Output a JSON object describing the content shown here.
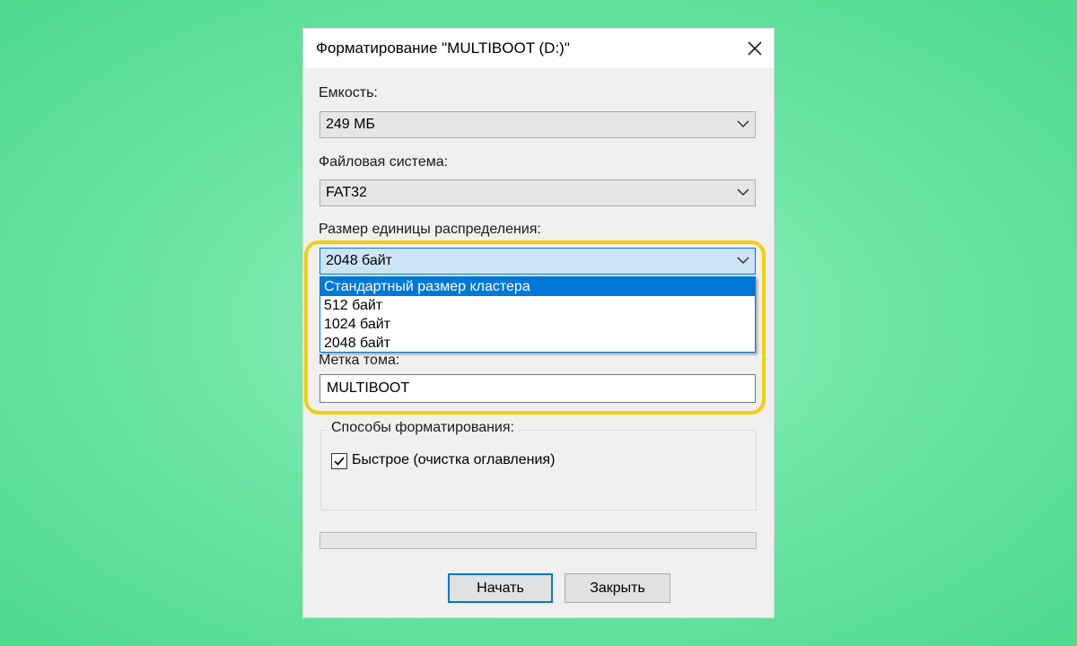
{
  "dialog": {
    "title": "Форматирование \"MULTIBOOT (D:)\"",
    "close_icon": "close-icon"
  },
  "capacity": {
    "label": "Емкость:",
    "value": "249 МБ"
  },
  "filesystem": {
    "label": "Файловая система:",
    "value": "FAT32"
  },
  "allocation": {
    "label": "Размер единицы распределения:",
    "value": "2048 байт",
    "options": [
      "Стандартный размер кластера",
      "512 байт",
      "1024 байт",
      "2048 байт"
    ],
    "highlighted_option": "Стандартный размер кластера"
  },
  "volume_label": {
    "label": "Метка тома:",
    "value": "MULTIBOOT"
  },
  "format_options": {
    "label": "Способы форматирования:",
    "quick": {
      "label": "Быстрое (очистка оглавления)",
      "checked": true
    }
  },
  "progress": {
    "value": 0
  },
  "buttons": {
    "start": "Начать",
    "close": "Закрыть"
  },
  "colors": {
    "accent": "#0078d7",
    "highlight_outline": "#f6cd0a",
    "background": "#5ddf97"
  }
}
